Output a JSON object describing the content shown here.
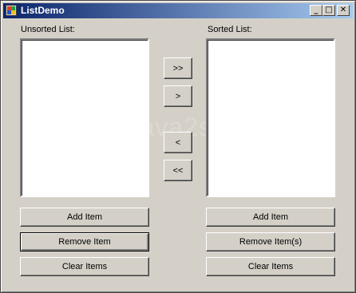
{
  "window": {
    "title": "ListDemo",
    "controls": {
      "minimize": "_",
      "maximize": "□",
      "close": "✕"
    },
    "icons": {
      "app": "app-icon"
    }
  },
  "unsorted": {
    "label": "Unsorted List:",
    "items": []
  },
  "sorted": {
    "label": "Sorted List:",
    "items": []
  },
  "transfer": {
    "move_all_right": ">>",
    "move_right": ">",
    "move_left": "<",
    "move_all_left": "<<"
  },
  "left_buttons": {
    "add": "Add Item",
    "remove": "Remove Item",
    "clear": "Clear Items"
  },
  "right_buttons": {
    "add": "Add Item",
    "remove": "Remove Item(s)",
    "clear": "Clear Items"
  },
  "watermark": "www.java2s.com",
  "colors": {
    "titlebar_start": "#0a246a",
    "titlebar_end": "#a6caf0",
    "face": "#d4d0c8"
  }
}
